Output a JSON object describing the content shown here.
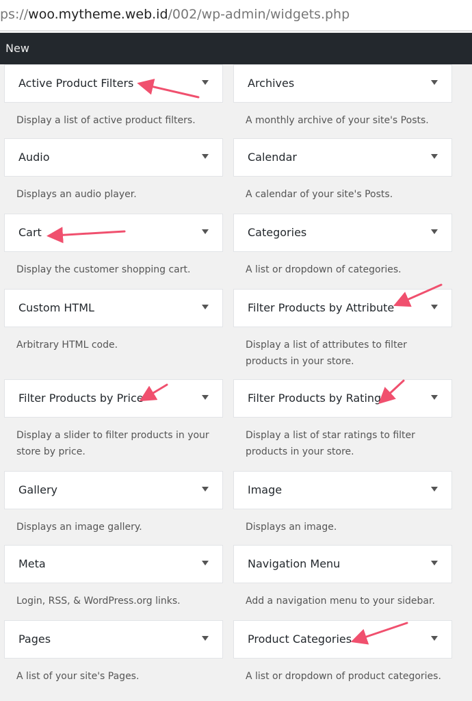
{
  "browser": {
    "url_prefix": "ps://",
    "url_domain": "woo.mytheme.web.id",
    "url_path": "/002/wp-admin/widgets.php"
  },
  "admin_bar": {
    "item": "New"
  },
  "accent_color": "#f0506e",
  "widgets": [
    {
      "title": "Active Product Filters",
      "desc": "Display a list of active product filters."
    },
    {
      "title": "Archives",
      "desc": "A monthly archive of your site's Posts."
    },
    {
      "title": "Audio",
      "desc": "Displays an audio player."
    },
    {
      "title": "Calendar",
      "desc": "A calendar of your site's Posts."
    },
    {
      "title": "Cart",
      "desc": "Display the customer shopping cart."
    },
    {
      "title": "Categories",
      "desc": "A list or dropdown of categories."
    },
    {
      "title": "Custom HTML",
      "desc": "Arbitrary HTML code."
    },
    {
      "title": "Filter Products by Attribute",
      "desc": "Display a list of attributes to filter products in your store."
    },
    {
      "title": "Filter Products by Price",
      "desc": "Display a slider to filter products in your store by price."
    },
    {
      "title": "Filter Products by Rating",
      "desc": "Display a list of star ratings to filter products in your store."
    },
    {
      "title": "Gallery",
      "desc": "Displays an image gallery."
    },
    {
      "title": "Image",
      "desc": "Displays an image."
    },
    {
      "title": "Meta",
      "desc": "Login, RSS, & WordPress.org links."
    },
    {
      "title": "Navigation Menu",
      "desc": "Add a navigation menu to your sidebar."
    },
    {
      "title": "Pages",
      "desc": "A list of your site's Pages."
    },
    {
      "title": "Product Categories",
      "desc": "A list or dropdown of product categories."
    }
  ]
}
